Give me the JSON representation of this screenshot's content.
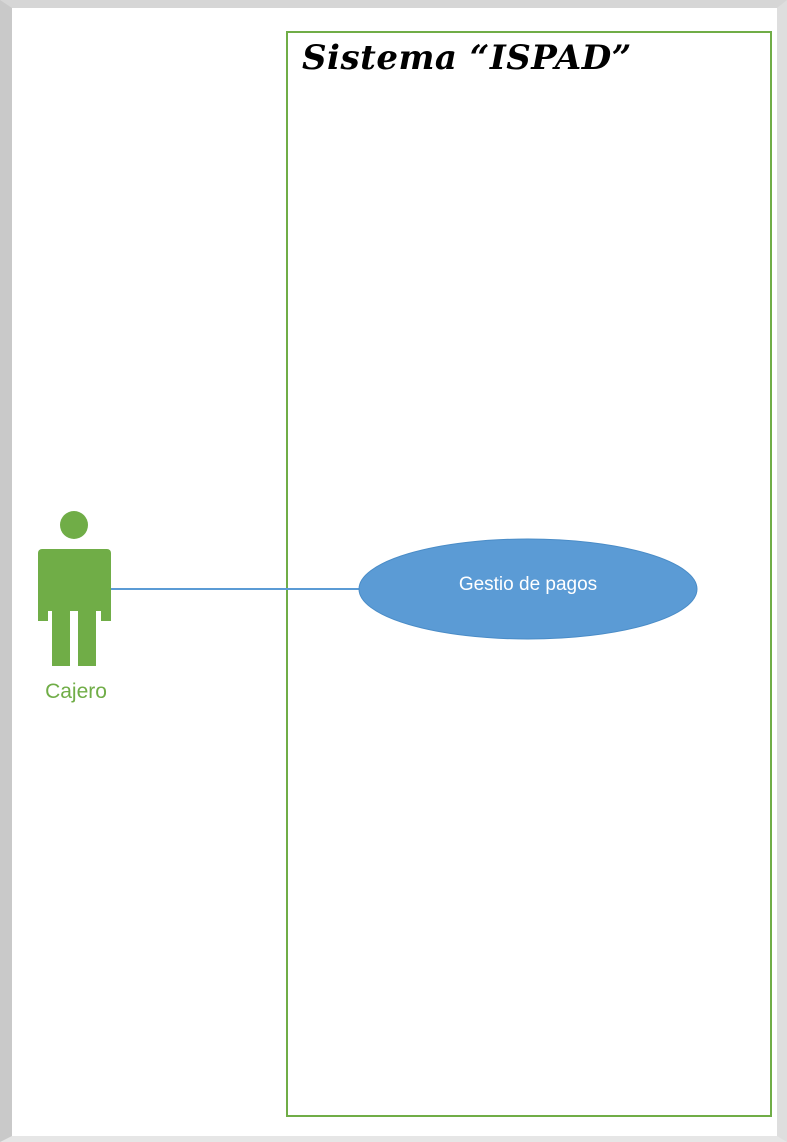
{
  "system": {
    "title": "Sistema “ISPAD”"
  },
  "actor": {
    "label": "Cajero",
    "icon": "person-icon"
  },
  "use_case": {
    "label": "Gestio de pagos"
  },
  "colors": {
    "actor": "#70ad47",
    "boundary": "#70ad47",
    "use_case_fill": "#5b9bd5",
    "association": "#5b9bd5"
  }
}
